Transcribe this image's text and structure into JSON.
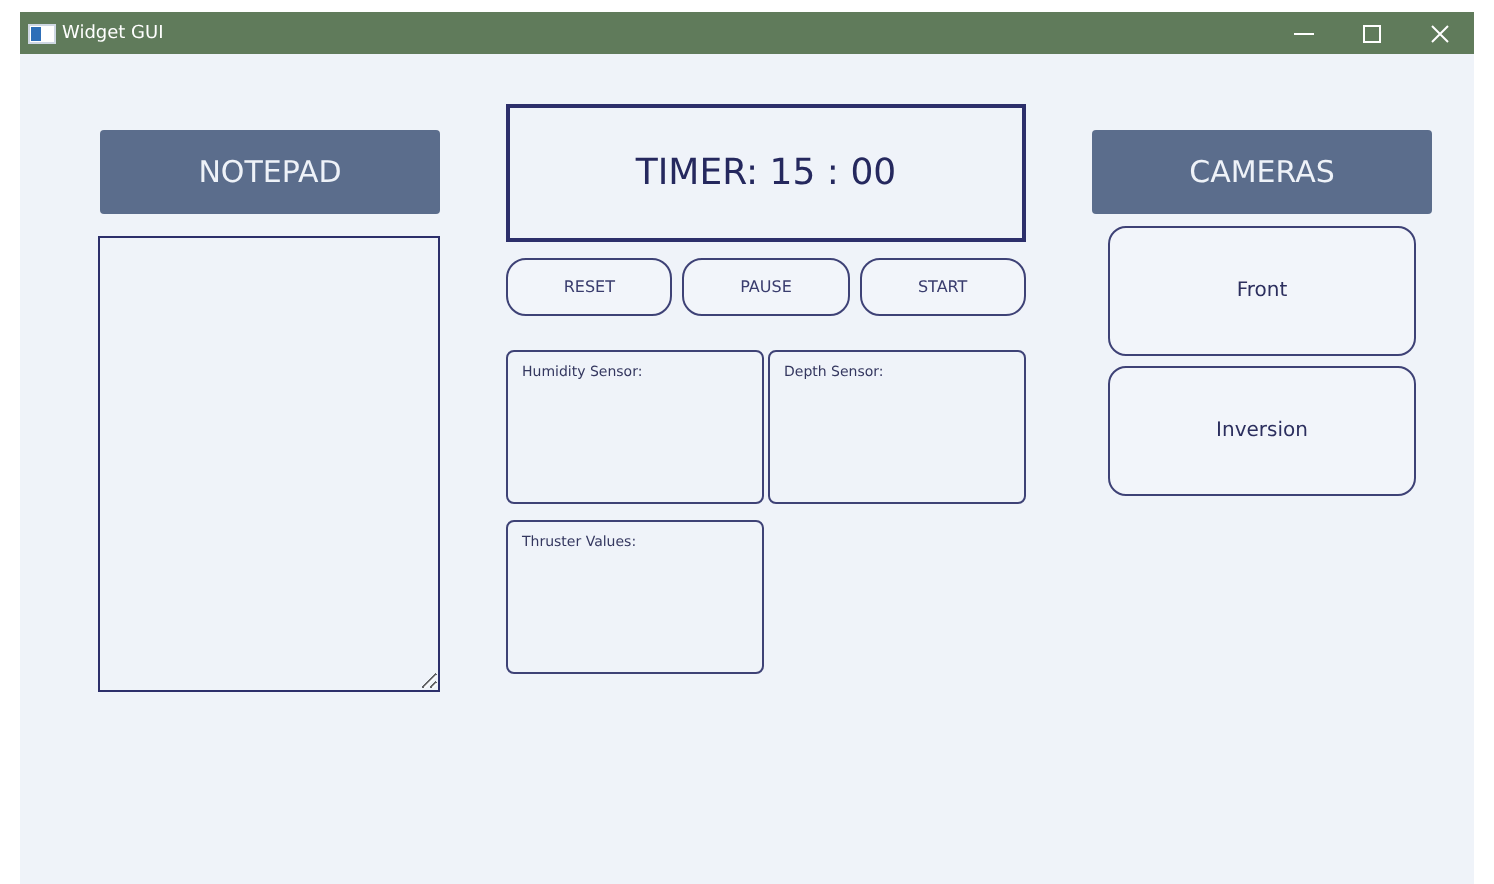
{
  "window": {
    "title": "Widget GUI"
  },
  "notepad": {
    "title": "NOTEPAD"
  },
  "timer": {
    "label": "TIMER: 15 : 00"
  },
  "timer_buttons": [
    "RESET",
    "PAUSE",
    "START"
  ],
  "sensors": [
    {
      "label": "Humidity Sensor:"
    },
    {
      "label": "Depth Sensor:"
    },
    {
      "label": "Thruster Values:"
    }
  ],
  "cameras": {
    "title": "CAMERAS",
    "buttons": [
      "Front",
      "Inversion"
    ]
  }
}
